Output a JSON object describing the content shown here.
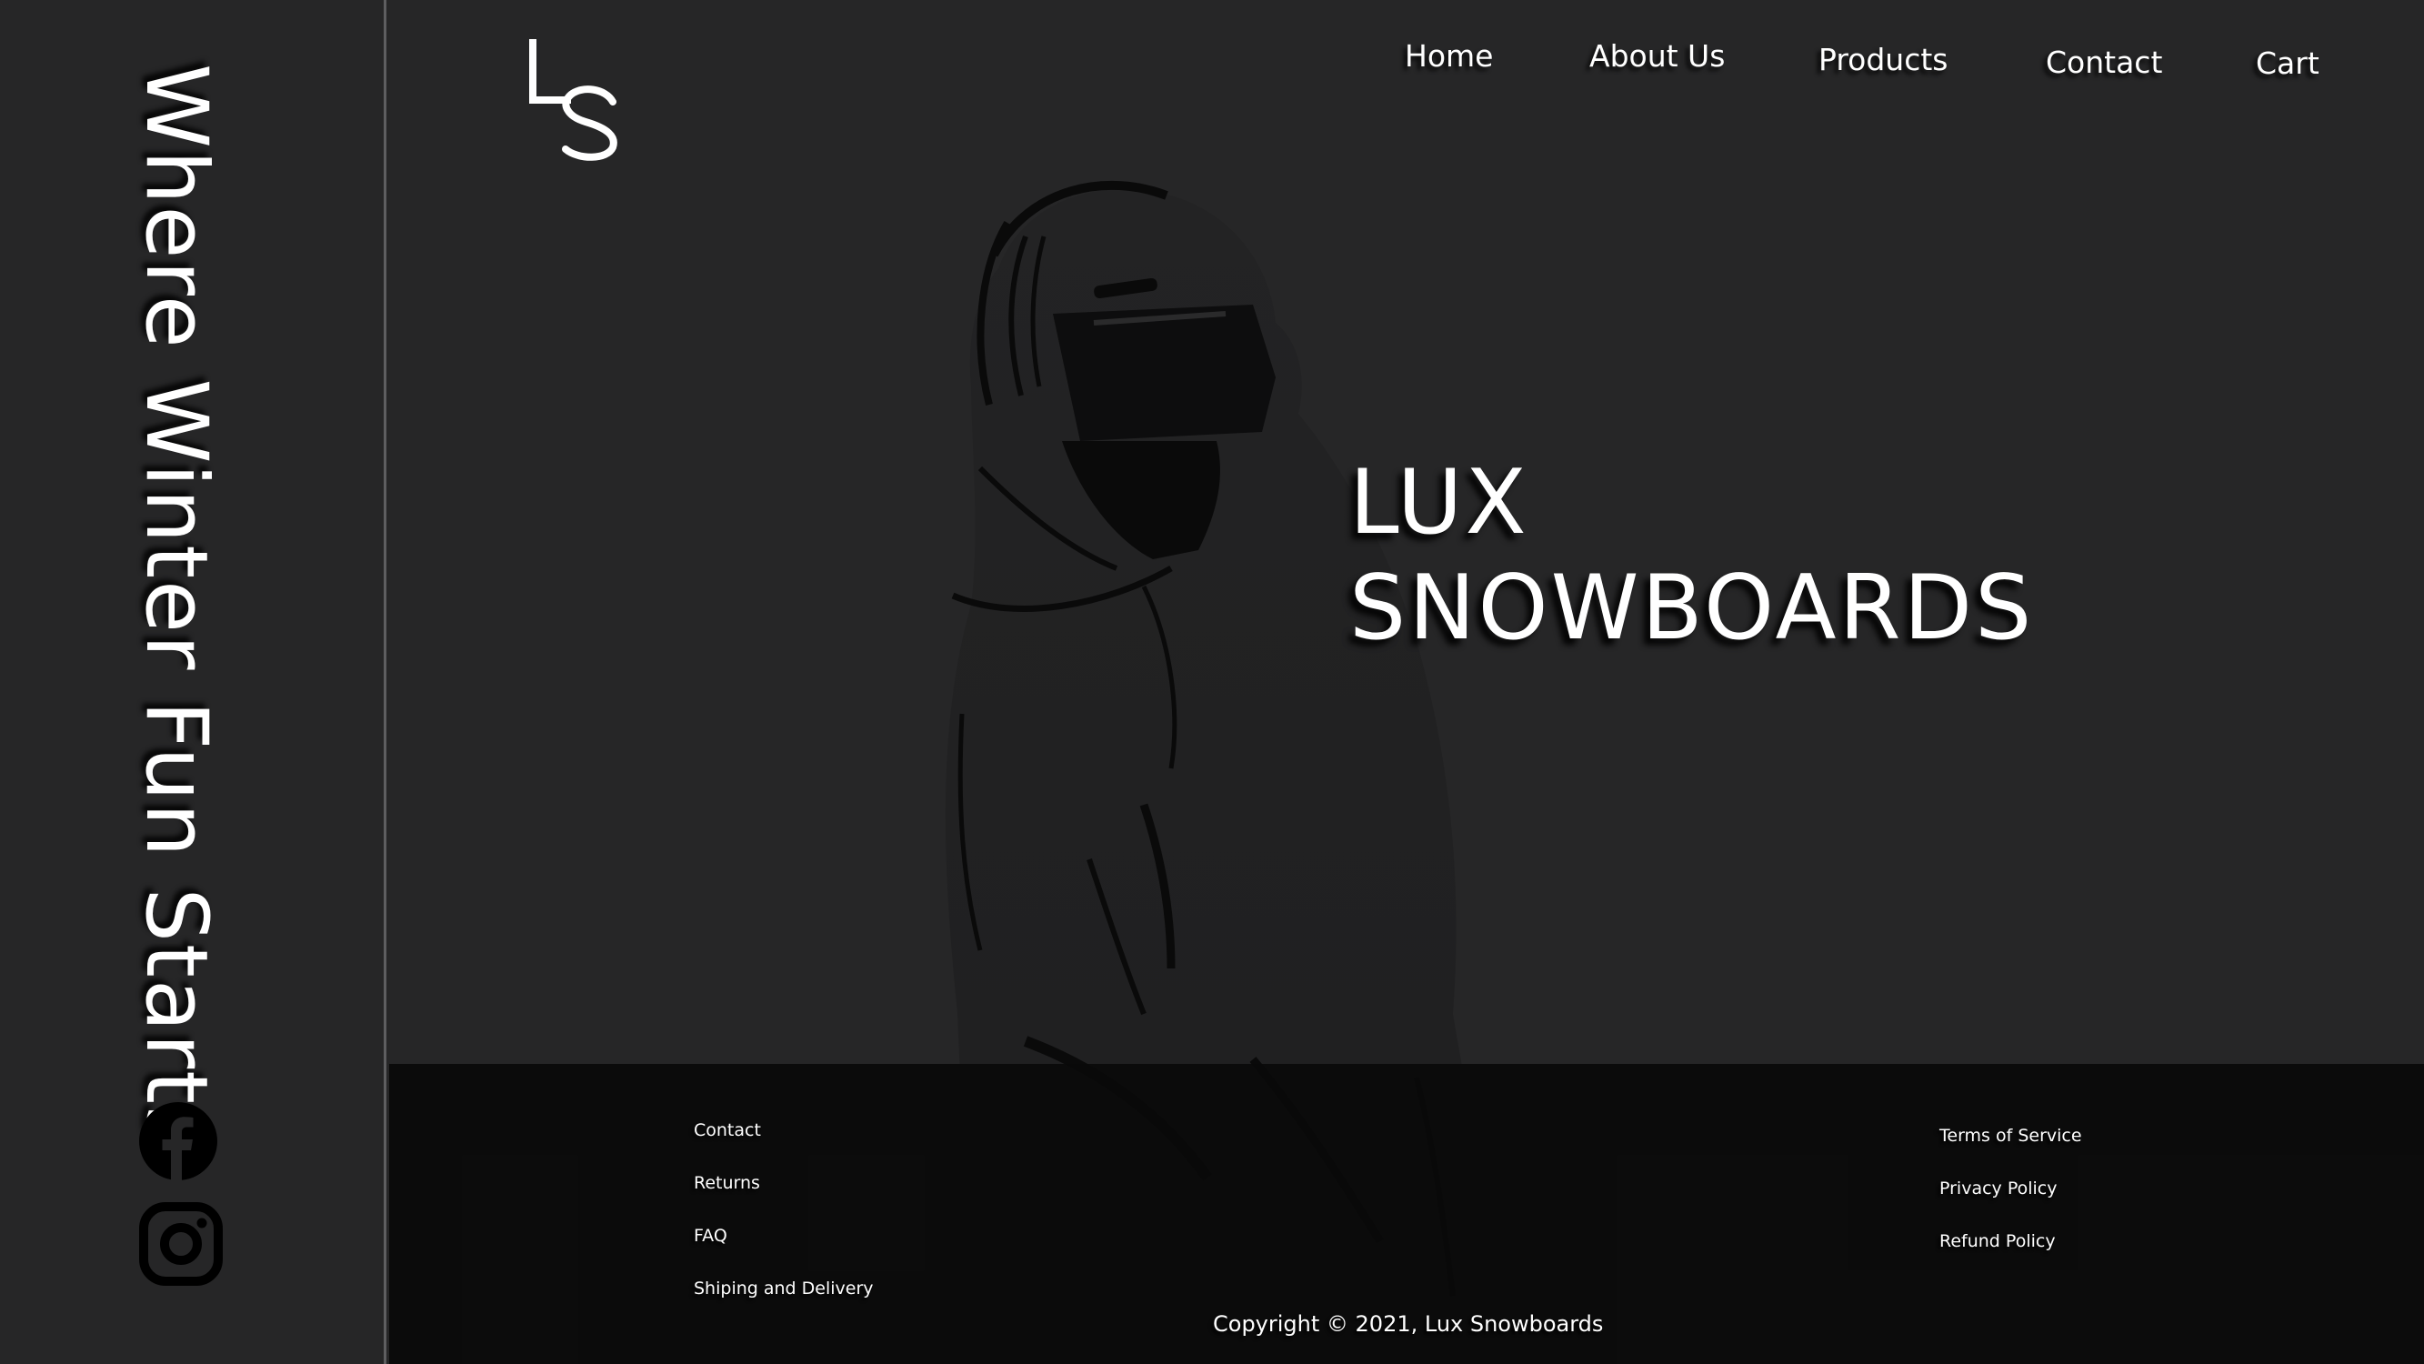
{
  "sidebar": {
    "tagline": "Where Winter Fun Starts",
    "social": [
      {
        "name": "facebook-icon"
      },
      {
        "name": "instagram-icon"
      }
    ]
  },
  "header": {
    "logo": {
      "icon": "ls-monogram-logo"
    },
    "nav": [
      {
        "label": "Home"
      },
      {
        "label": "About Us"
      },
      {
        "label": "Products"
      },
      {
        "label": "Contact"
      },
      {
        "label": "Cart"
      }
    ]
  },
  "hero": {
    "title_line1": "LUX",
    "title_line2": "SNOWBOARDS",
    "image": "snowboarder-with-helmet-and-goggles-silhouette"
  },
  "footer": {
    "left_links": [
      {
        "label": "Contact"
      },
      {
        "label": "Returns"
      },
      {
        "label": "FAQ"
      },
      {
        "label": "Shiping and Delivery"
      }
    ],
    "right_links": [
      {
        "label": "Terms of Service"
      },
      {
        "label": "Privacy Policy"
      },
      {
        "label": "Refund Policy"
      }
    ],
    "copyright": "Copyright © 2021, Lux Snowboards"
  },
  "colors": {
    "background": "#262627",
    "footer": "#0b0b0b",
    "text": "#ffffff",
    "divider": "#5e5e60"
  }
}
